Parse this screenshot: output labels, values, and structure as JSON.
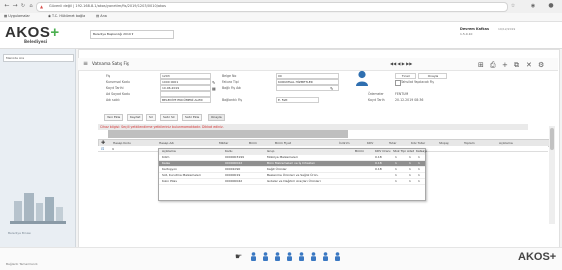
{
  "browser": {
    "url": "Güvenli değil | 192.168.8.1/akos/yonetim/fis/2019/1203/0010/akos",
    "bookmarks": [
      "Uygulamalar",
      "T.C. Hükümet bağla",
      "Ana"
    ]
  },
  "app": {
    "logo": "AKOS",
    "logo_plus": "+",
    "subtitle": "Belediyesi",
    "company_select": "Belediye Başkanlığı 2019 ▾",
    "user_name": "Devrem Kafkas",
    "user_date": "1.5.0.10",
    "user_version": "19/12/2019"
  },
  "sidebar": {
    "search_placeholder": "Menüde Ara",
    "art_caption": "Belediye Binası"
  },
  "window": {
    "title": "Vatnama Satış Fiş",
    "record_nav": "◀◀  ◀  ▶  ▶▶"
  },
  "form": {
    "left": [
      {
        "label": "Fiş",
        "value": "1203"
      },
      {
        "label": "Kurumsal Kodu",
        "value": "1000 0001"
      },
      {
        "label": "Kayıt Tarihi",
        "value": "10.06.2019"
      },
      {
        "label": "Ad Soyad Kodu",
        "value": ""
      },
      {
        "label": "Adı soldı",
        "value": "BELEDİYE ENCÜMENİ ALIMI"
      }
    ],
    "middle": [
      {
        "label": "Belge No",
        "value": "00"
      },
      {
        "label": "Fatura Tipi",
        "value": "KURUMSAL HİZMETLER"
      },
      {
        "label": "Bağlı Fiş Adı",
        "value": ""
      },
      {
        "label": "",
        "value": ""
      },
      {
        "label": "Bağlantılı Fiş",
        "value": "E. Fatt"
      }
    ],
    "right": [
      {
        "label": "Ticari",
        "value": "Onayla"
      },
      {
        "label": "Ödemeler",
        "value": "FENTUM"
      },
      {
        "label": "Kayıt Tarih",
        "value": "20.12.2019 08:36"
      }
    ],
    "checkbox_label": "Tahsilat Yapılacak Fiş"
  },
  "actions": [
    "Yeni Ekle",
    "Kaydet",
    "Sil",
    "Satır Sil",
    "Satır Ekle",
    "Onayla"
  ],
  "alert_text": "Cihaz bilgisi: Seçili yetkilendirme yetkileriniz bulunmamaktadır. Dikkat ediniz.",
  "grid": {
    "columns": [
      "Hesap Kodu",
      "Hesap Adı",
      "Miktar",
      "Birim",
      "Birim Fiyat",
      "İndirim",
      "KDV",
      "Tutar",
      "Kdv Tutar",
      "Stopaj",
      "Toplam",
      "Açıklama"
    ],
    "row": [
      "9",
      "",
      "1",
      "Adet",
      "",
      "",
      "",
      "",
      "",
      "",
      "",
      ""
    ]
  },
  "dropdown": {
    "columns": [
      "Açıklama",
      "Kodu",
      "Grup",
      "Birimi",
      "KDV Oranı",
      "Stok Tipi",
      "Adet",
      "Katsayı"
    ],
    "rows": [
      [
        "Kilim",
        "0000003199",
        "Mobilya Malzemeleri",
        "",
        "0.18",
        "1",
        "1",
        "1"
      ],
      [
        "Kalas",
        "000000022",
        "Büro Malzemeleri ve İş Cihazları",
        "",
        "0.18",
        "1",
        "1",
        "1"
      ],
      [
        "Kartoşyon",
        "00001090",
        "Kağıt Ürünler",
        "",
        "0.18",
        "1",
        "1",
        "1"
      ],
      [
        "Süt, Kurutma Malzemeleri",
        "00000019",
        "Beslenme Ürünleri ve Sağlık Ürün.",
        "",
        "",
        "1",
        "1",
        "1"
      ],
      [
        "Kızın Pilav",
        "000000042",
        "Gıdalar ve Dağıtım Araçları Ürünleri",
        "",
        "",
        "1",
        "1",
        "1"
      ]
    ],
    "selected_row": 1
  },
  "footer": {
    "logo": "AKOS+",
    "status": "Bağlantı Tamamlandı"
  },
  "colors": {
    "accent_green": "#4caf50",
    "alert_red": "#d32f2f",
    "selected_gray": "#8f8f8f"
  }
}
